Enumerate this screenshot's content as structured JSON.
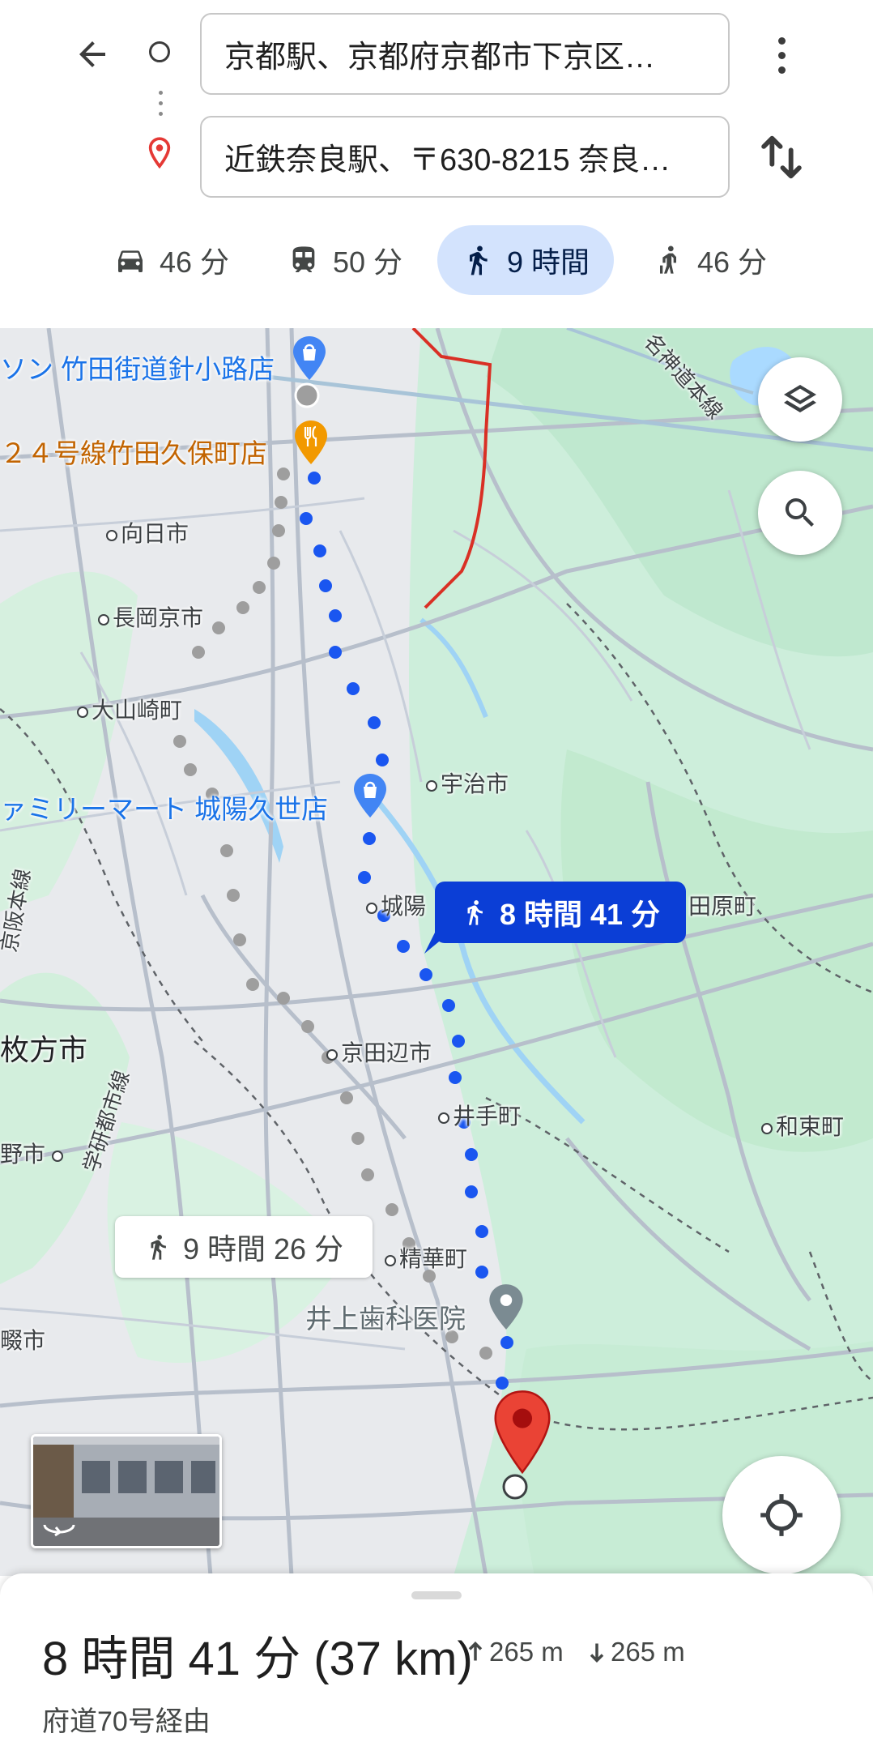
{
  "header": {
    "origin": "京都駅、京都府京都市下京区…",
    "destination": "近鉄奈良駅、〒630-8215 奈良…"
  },
  "modes": [
    {
      "icon": "car-icon",
      "label": "46 分",
      "active": false
    },
    {
      "icon": "train-icon",
      "label": "50 分",
      "active": false
    },
    {
      "icon": "walk-icon",
      "label": "9 時間",
      "active": true
    },
    {
      "icon": "ride-icon",
      "label": "46 分",
      "active": false
    }
  ],
  "map": {
    "poi": {
      "lawson": "ソン 竹田街道針小路店",
      "restaurant": "２４号線竹田久保町店",
      "familymart": "ァミリーマート 城陽久世店",
      "dental": "井上歯科医院"
    },
    "places": {
      "muko": "向日市",
      "nagaokakyo": "長岡京市",
      "oyamazaki": "大山崎町",
      "uji": "宇治市",
      "joyo": "城陽",
      "kyotanabe": "京田辺市",
      "ide": "井手町",
      "wazuka": "和束町",
      "seika": "精華町",
      "hirakata": "枚方市",
      "ujitawara": "田原町",
      "katano": "野市",
      "shijonawate": "畷市"
    },
    "lines": {
      "keihan": "京阪本線",
      "gakken": "学研都市線",
      "meishin": "名神道本線"
    },
    "route_callout": "8 時間 41 分",
    "alt_callout": "9 時間 26 分",
    "colors": {
      "route": "#1a56f0",
      "alt_route": "#9e9e9e",
      "callout": "#0b3ed6"
    }
  },
  "summary": {
    "duration": "8 時間 41 分 (37 km)",
    "ascent": "265 m",
    "descent": "265 m",
    "via": "府道70号経由"
  }
}
